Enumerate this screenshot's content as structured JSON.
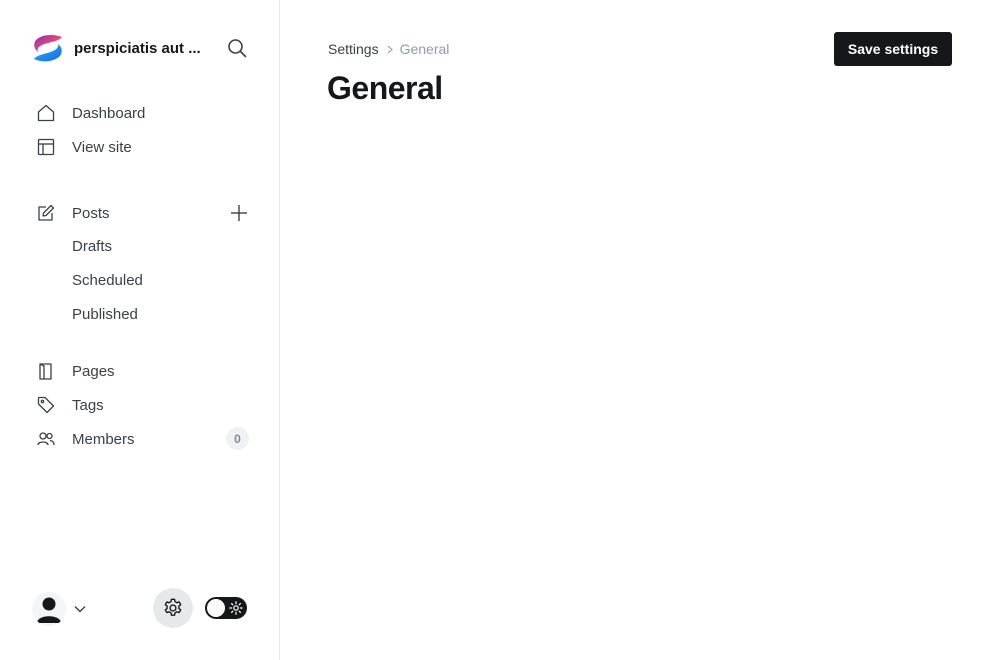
{
  "sidebar": {
    "site_title": "perspiciatis aut ...",
    "nav_top": [
      {
        "label": "Dashboard",
        "icon": "home-icon"
      },
      {
        "label": "View site",
        "icon": "layout-icon"
      }
    ],
    "posts": {
      "label": "Posts",
      "icon": "edit-icon",
      "subitems": [
        "Drafts",
        "Scheduled",
        "Published"
      ]
    },
    "nav_bottom": [
      {
        "label": "Pages",
        "icon": "page-icon"
      },
      {
        "label": "Tags",
        "icon": "tag-icon"
      },
      {
        "label": "Members",
        "icon": "members-icon",
        "count": "0"
      }
    ],
    "footer": {
      "night_mode": false
    }
  },
  "header": {
    "breadcrumb": {
      "parent": "Settings",
      "current": "General"
    },
    "title": "General",
    "save_label": "Save settings"
  },
  "colors": {
    "primary_button": "#15171a",
    "text": "#15171a",
    "muted": "#8e9cac",
    "border": "#e8ebee"
  }
}
